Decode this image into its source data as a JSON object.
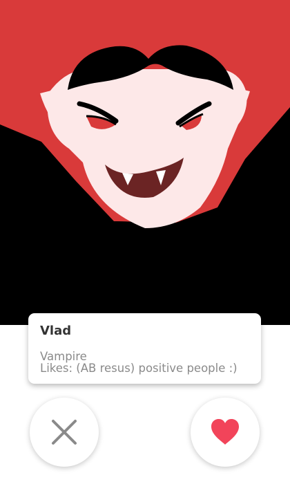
{
  "profile": {
    "name": "Vlad",
    "occupation": "Vampire",
    "likes": "Likes: (AB resus) positive people :)"
  },
  "actions": {
    "dislike_icon": "close-icon",
    "like_icon": "heart-icon"
  },
  "colors": {
    "photo_background": "#d93a3a",
    "like_heart": "#f2445a",
    "dislike_x": "#8a8a8a",
    "cape": "#000000",
    "skin": "#fde8e8"
  }
}
